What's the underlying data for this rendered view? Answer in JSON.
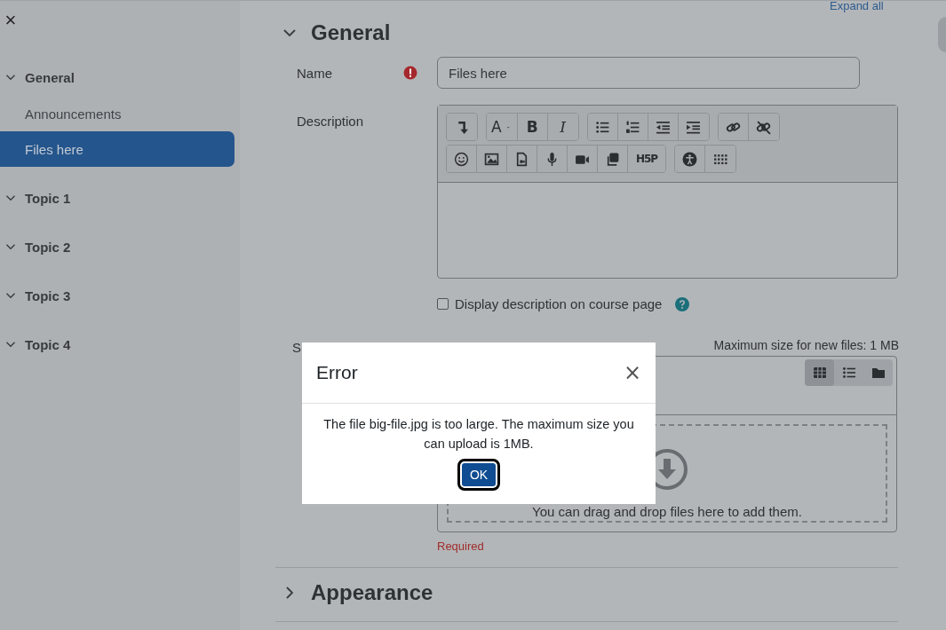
{
  "drawer": {
    "close": "×",
    "items": [
      {
        "label": "General",
        "expanded": true,
        "selected": false,
        "children": [
          {
            "label": "Announcements",
            "selected": false
          },
          {
            "label": "Files here",
            "selected": true
          }
        ]
      },
      {
        "label": "Topic 1",
        "expanded": true,
        "selected": false
      },
      {
        "label": "Topic 2",
        "expanded": true,
        "selected": false
      },
      {
        "label": "Topic 3",
        "expanded": true,
        "selected": false
      },
      {
        "label": "Topic 4",
        "expanded": true,
        "selected": false
      }
    ]
  },
  "expand_all": "Expand all",
  "sections": [
    {
      "title": "General",
      "expanded": true,
      "fields": [
        {
          "kind": "text",
          "label": "Name",
          "required": true,
          "value": "Files here"
        },
        {
          "kind": "editor",
          "label": "Description",
          "toolbar": [
            [
              [
                {
                  "kind": "paragraph"
                }
              ],
              [
                {
                  "kind": "font",
                  "label": "A"
                },
                {
                  "kind": "bold",
                  "label": "B"
                },
                {
                  "kind": "italic",
                  "label": "I"
                }
              ],
              [
                {
                  "kind": "ul"
                },
                {
                  "kind": "ol"
                },
                {
                  "kind": "outdent"
                },
                {
                  "kind": "indent"
                }
              ],
              [
                {
                  "kind": "link"
                },
                {
                  "kind": "unlink"
                }
              ]
            ],
            [
              [
                {
                  "kind": "emoji"
                },
                {
                  "kind": "image"
                },
                {
                  "kind": "media"
                },
                {
                  "kind": "audio"
                },
                {
                  "kind": "video"
                },
                {
                  "kind": "copy"
                },
                {
                  "kind": "h5p",
                  "label": "H5P"
                }
              ],
              [
                {
                  "kind": "accessibility"
                },
                {
                  "kind": "more"
                }
              ]
            ]
          ]
        },
        {
          "kind": "checkbox",
          "label": "Display description on course page",
          "checked": false,
          "help": true
        },
        {
          "kind": "filepicker",
          "label": "S",
          "max_size": "Maximum size for new files: 1 MB",
          "views": [
            {
              "kind": "grid",
              "selected": true
            },
            {
              "kind": "list",
              "selected": false
            },
            {
              "kind": "folder",
              "selected": false
            }
          ],
          "drop_text": "You can drag and drop files here to add them.",
          "error": "Required"
        }
      ]
    },
    {
      "title": "Appearance",
      "expanded": false
    }
  ],
  "dialog": {
    "title": "Error",
    "close": "×",
    "message": "The file big-file.jpg is too large. The maximum size you can upload is 1MB.",
    "button": "OK"
  }
}
